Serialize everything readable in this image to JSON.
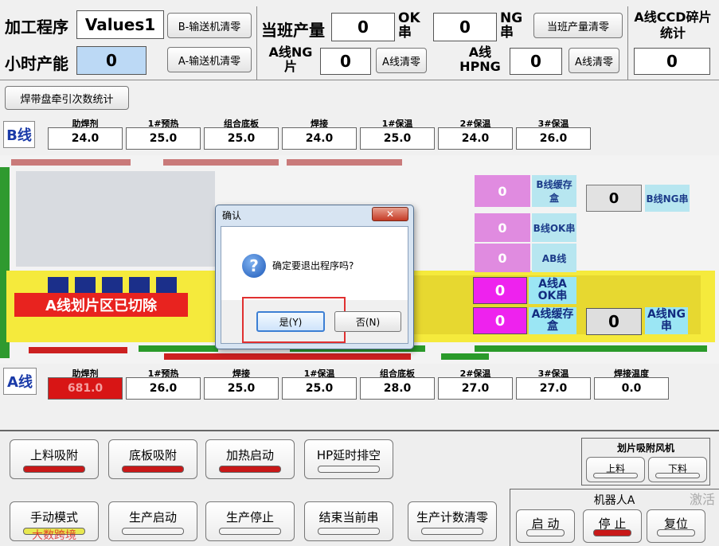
{
  "header": {
    "program_label": "加工程序",
    "program_value": "Values1",
    "hourly_label": "小时产能",
    "hourly_value": "0",
    "b_conveyor_reset": "B-输送机清零",
    "a_conveyor_reset": "A-输送机清零",
    "shift_output_label": "当班产量",
    "shift_output_value": "0",
    "ok_string_label": "OK串",
    "ok_string_value": "0",
    "ng_string_label": "NG串",
    "ng_string_value": "0",
    "shift_output_reset": "当班产量清零",
    "a_ng_label": "A线NG片",
    "a_ng_value": "0",
    "a_reset_1": "A线清零",
    "a_hpng_label": "A线HPNG",
    "a_hpng_value": "0",
    "a_reset_2": "A线清零",
    "ccd_label": "A线CCD碎片统计",
    "ccd_value": "0"
  },
  "weld_count_button": "焊带盘牵引次数统计",
  "b_line": {
    "tag": "B线",
    "params": [
      {
        "label": "助焊剂",
        "value": "24.0"
      },
      {
        "label": "1#预热",
        "value": "25.0"
      },
      {
        "label": "组合底板",
        "value": "25.0"
      },
      {
        "label": "焊接",
        "value": "24.0"
      },
      {
        "label": "1#保温",
        "value": "25.0"
      },
      {
        "label": "2#保温",
        "value": "24.0"
      },
      {
        "label": "3#保温",
        "value": "26.0"
      }
    ]
  },
  "machine": {
    "b_counters": [
      {
        "value": "0",
        "label": "B线缓存盒"
      },
      {
        "value": "0",
        "label": "B线NG串"
      },
      {
        "value": "0",
        "label": "B线OK串"
      },
      {
        "value": "0",
        "label": "AB线"
      }
    ],
    "a_ok_value": "0",
    "a_ok_label": "A线A OK串",
    "a_cache_value": "0",
    "a_cache_label": "A线缓存盒",
    "a_ng_string_value": "0",
    "a_ng_string_label": "A线NG串",
    "cut_banner": "A线划片区已切除"
  },
  "a_line": {
    "tag": "A线",
    "params": [
      {
        "label": "助焊剂",
        "value": "681.0",
        "alarm": true
      },
      {
        "label": "1#预热",
        "value": "26.0"
      },
      {
        "label": "焊接",
        "value": "25.0"
      },
      {
        "label": "1#保温",
        "value": "25.0"
      },
      {
        "label": "组合底板",
        "value": "28.0"
      },
      {
        "label": "2#保温",
        "value": "27.0"
      },
      {
        "label": "3#保温",
        "value": "27.0"
      },
      {
        "label": "焊接温度",
        "value": "0.0"
      }
    ]
  },
  "controls": {
    "row1": [
      {
        "label": "上料吸附",
        "state": "on"
      },
      {
        "label": "底板吸附",
        "state": "on"
      },
      {
        "label": "加热启动",
        "state": "on"
      },
      {
        "label": "HP延时排空",
        "state": "off"
      }
    ],
    "row2": [
      {
        "label": "手动模式",
        "state": "yellow"
      },
      {
        "label": "生产启动",
        "state": "off"
      },
      {
        "label": "生产停止",
        "state": "off"
      },
      {
        "label": "结束当前串",
        "state": "off"
      },
      {
        "label": "生产计数清零",
        "state": "off"
      }
    ],
    "fan_group_title": "划片吸附风机",
    "fan_load": "上料",
    "fan_unload": "下料",
    "robot_title": "机器人A",
    "robot_start": "启 动",
    "robot_stop": "停 止",
    "robot_reset": "复位"
  },
  "dialog": {
    "title": "确认",
    "message": "确定要退出程序吗?",
    "yes": "是(Y)",
    "no": "否(N)"
  },
  "watermark_left": "大数跨境",
  "watermark_right": "激活"
}
